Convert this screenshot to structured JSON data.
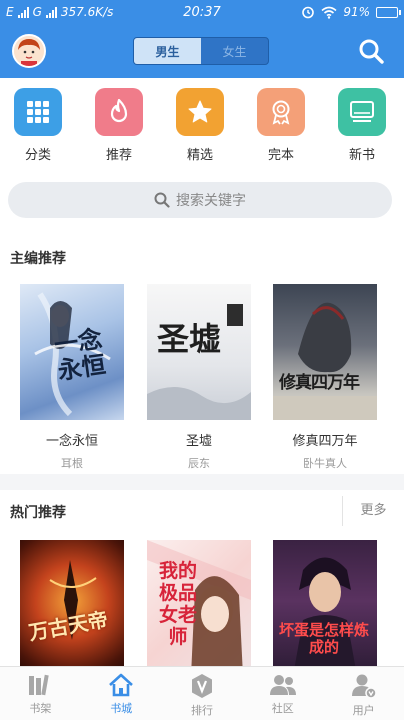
{
  "status": {
    "net_label_1": "E",
    "net_label_2": "G",
    "speed": "357.6K/s",
    "time": "20:37",
    "battery": "91%",
    "battery_level": 0.91
  },
  "header": {
    "tab_male": "男生",
    "tab_female": "女生"
  },
  "categories": [
    {
      "label": "分类",
      "icon": "grid-icon",
      "color": "#3d9fe6"
    },
    {
      "label": "推荐",
      "icon": "flame-icon",
      "color": "#f07c8a"
    },
    {
      "label": "精选",
      "icon": "star-icon",
      "color": "#f2a232"
    },
    {
      "label": "完本",
      "icon": "medal-icon",
      "color": "#f4a078"
    },
    {
      "label": "新书",
      "icon": "screen-icon",
      "color": "#3ec1a3"
    }
  ],
  "search": {
    "placeholder": "搜索关键字"
  },
  "editor_section": {
    "title": "主编推荐",
    "books": [
      {
        "name": "一念永恒",
        "author": "耳根",
        "cover_text": "一念永恒"
      },
      {
        "name": "圣墟",
        "author": "辰东",
        "cover_text": "圣墟"
      },
      {
        "name": "修真四万年",
        "author": "卧牛真人",
        "cover_text": "修真四万年"
      }
    ]
  },
  "hot_section": {
    "title": "热门推荐",
    "more": "更多",
    "books": [
      {
        "cover_text": "万古天帝"
      },
      {
        "cover_text": "我的极品女老师"
      },
      {
        "cover_text": "坏蛋是怎样炼成的"
      }
    ]
  },
  "bottom_nav": [
    {
      "label": "书架",
      "icon": "bookshelf-icon"
    },
    {
      "label": "书城",
      "icon": "home-icon"
    },
    {
      "label": "排行",
      "icon": "rank-badge-icon"
    },
    {
      "label": "社区",
      "icon": "community-icon"
    },
    {
      "label": "用户",
      "icon": "user-icon"
    }
  ],
  "colors": {
    "accent": "#3a8ee6",
    "active_nav": "#3a8ee6"
  }
}
